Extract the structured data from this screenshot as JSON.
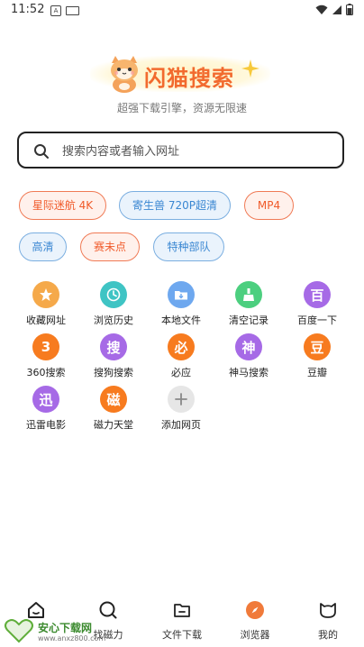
{
  "status_bar": {
    "time": "11:52",
    "sim_label": "A"
  },
  "logo": {
    "title": "闪猫搜索"
  },
  "tagline": "超强下载引擎，资源无限速",
  "search": {
    "placeholder": "搜索内容或者输入网址",
    "value": ""
  },
  "tags": [
    {
      "label": "星际迷航 4K",
      "style": "orange"
    },
    {
      "label": "寄生兽 720P超清",
      "style": "blue"
    },
    {
      "label": "MP4",
      "style": "orange"
    },
    {
      "label": "高清",
      "style": "blue"
    },
    {
      "label": "赛未点",
      "style": "orange"
    },
    {
      "label": "特种部队",
      "style": "blue"
    }
  ],
  "grid": [
    {
      "label": "收藏网址",
      "icon": "star-icon",
      "glyph": "★",
      "color": "#f5a94a"
    },
    {
      "label": "浏览历史",
      "icon": "clock-icon",
      "glyph": "",
      "color": "#3fc4c4"
    },
    {
      "label": "本地文件",
      "icon": "folder-download-icon",
      "glyph": "",
      "color": "#6ea8ef"
    },
    {
      "label": "清空记录",
      "icon": "broom-icon",
      "glyph": "",
      "color": "#4ccf7f"
    },
    {
      "label": "百度一下",
      "icon": "baidu-icon",
      "glyph": "百",
      "color": "#a66ae6"
    },
    {
      "label": "360搜索",
      "icon": "360-icon",
      "glyph": "3",
      "color": "#f77b1f"
    },
    {
      "label": "搜狗搜索",
      "icon": "sogou-icon",
      "glyph": "搜",
      "color": "#a66ae6"
    },
    {
      "label": "必应",
      "icon": "bing-icon",
      "glyph": "必",
      "color": "#f77b1f"
    },
    {
      "label": "神马搜索",
      "icon": "shenma-icon",
      "glyph": "神",
      "color": "#a66ae6"
    },
    {
      "label": "豆瓣",
      "icon": "douban-icon",
      "glyph": "豆",
      "color": "#f77b1f"
    },
    {
      "label": "迅雷电影",
      "icon": "xunlei-icon",
      "glyph": "迅",
      "color": "#a66ae6"
    },
    {
      "label": "磁力天堂",
      "icon": "cili-icon",
      "glyph": "磁",
      "color": "#f77b1f"
    },
    {
      "label": "添加网页",
      "icon": "add-icon",
      "glyph": "+",
      "color": "#e6e6e6"
    }
  ],
  "bottom_nav": [
    {
      "label": "",
      "icon": "home-icon"
    },
    {
      "label": "找磁力",
      "icon": "magnet-search-icon"
    },
    {
      "label": "文件下载",
      "icon": "file-download-icon"
    },
    {
      "label": "浏览器",
      "icon": "compass-icon"
    },
    {
      "label": "我的",
      "icon": "cat-face-icon"
    }
  ],
  "watermark": {
    "title": "安心下载网",
    "url": "www.anxz800.com",
    "badge": "安心\n笑奥"
  },
  "colors": {
    "accent": "#f26a2e",
    "tag_orange": "#f05a2a",
    "tag_blue": "#3a87d2",
    "nav_active": "#f07a3a"
  }
}
